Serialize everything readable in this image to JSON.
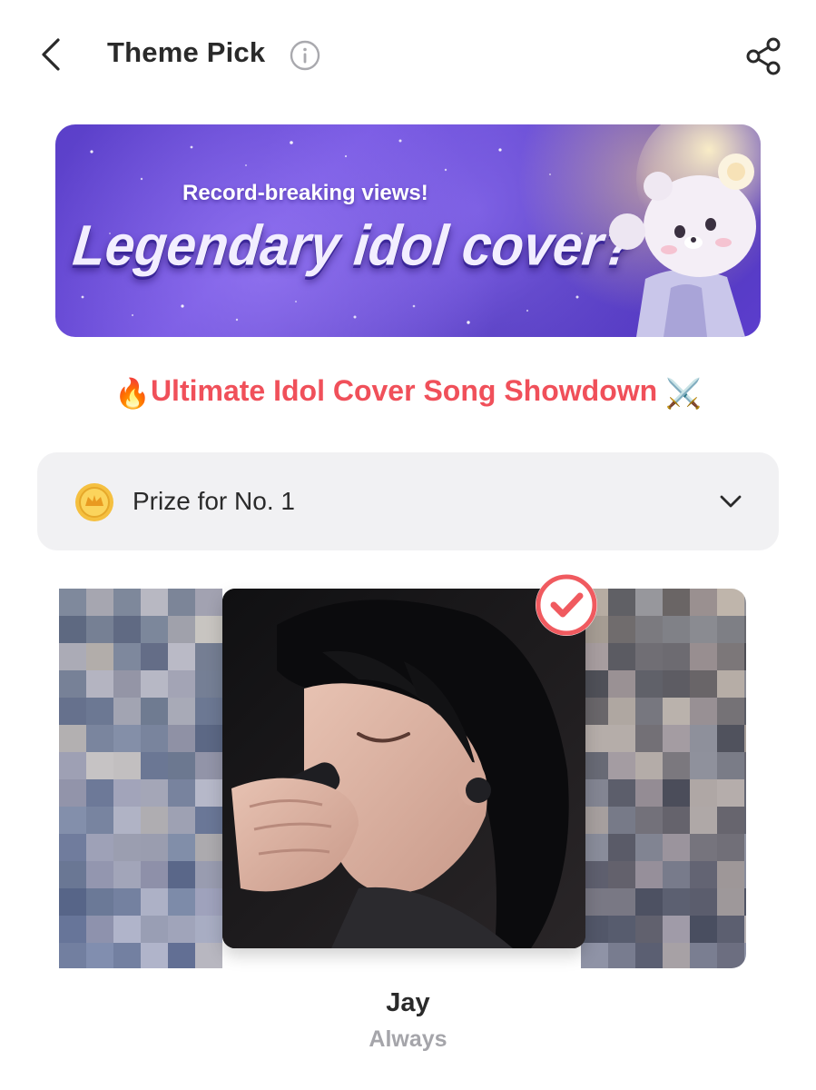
{
  "header": {
    "title": "Theme Pick",
    "back_icon": "chevron-left-icon",
    "info_icon": "info-icon",
    "share_icon": "share-icon"
  },
  "banner": {
    "subtitle": "Record-breaking views!",
    "headline": "Legendary idol cover?"
  },
  "showdown": {
    "leading_emoji": "🔥",
    "text": "Ultimate Idol Cover Song Showdown",
    "trailing_emoji": "⚔️"
  },
  "prize": {
    "label": "Prize for No. 1",
    "icon": "coin-icon",
    "expand_icon": "chevron-down-icon"
  },
  "selected_entry": {
    "artist": "Jay",
    "song": "Always",
    "selected": true
  },
  "colors": {
    "accent_red": "#f0505a",
    "check_red": "#f05a5f",
    "prize_bg": "#f1f1f3",
    "muted_text": "#a5a5aa",
    "banner_purple": "#5a3fc8"
  }
}
